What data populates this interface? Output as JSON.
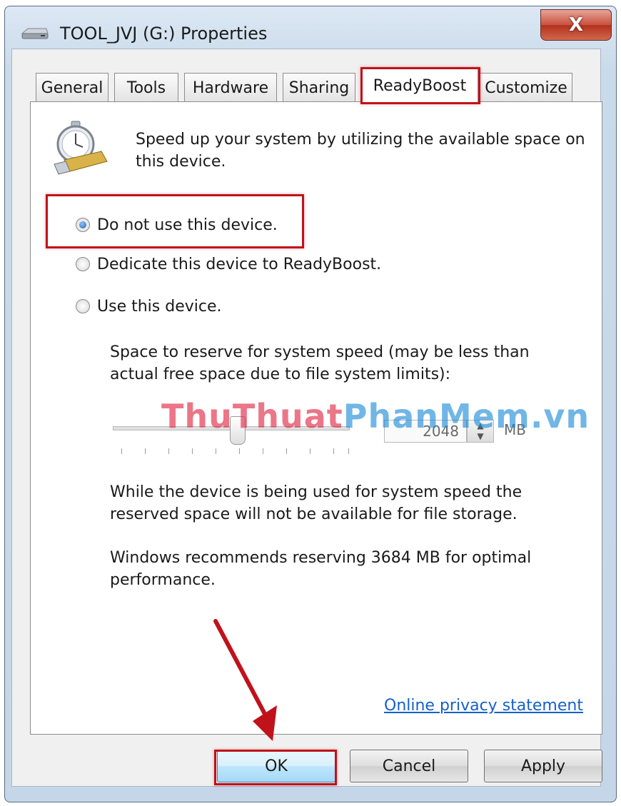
{
  "window": {
    "title": "TOOL_JVJ (G:) Properties",
    "close_glyph": "X"
  },
  "tabs": [
    {
      "label": "General"
    },
    {
      "label": "Tools"
    },
    {
      "label": "Hardware"
    },
    {
      "label": "Sharing"
    },
    {
      "label": "ReadyBoost",
      "active": true
    },
    {
      "label": "Customize"
    }
  ],
  "readyboost": {
    "description": "Speed up your system by utilizing the available space on this device.",
    "options": [
      {
        "label": "Do not use this device.",
        "selected": true
      },
      {
        "label": "Dedicate this device to ReadyBoost.",
        "selected": false
      },
      {
        "label": "Use this device.",
        "selected": false
      }
    ],
    "reserve_label": "Space to reserve for system speed (may be less than actual free space due to file system limits):",
    "reserve_value": "2048",
    "reserve_unit": "MB",
    "storage_note": "While the device is being used for system speed the reserved space will not be available for file storage.",
    "recommendation": "Windows recommends reserving 3684 MB for optimal performance.",
    "privacy_link": "Online privacy statement"
  },
  "buttons": {
    "ok": "OK",
    "cancel": "Cancel",
    "apply": "Apply"
  },
  "watermark": {
    "part1": "ThuThuat",
    "part2": "PhanMem.vn"
  },
  "icons": {
    "title": "drive-icon",
    "feature": "readyboost-stopwatch-icon",
    "spin": "spin-updown-icon"
  },
  "colors": {
    "highlight": "#c0121b",
    "link": "#1560c9",
    "accent": "#3c7fb1"
  }
}
